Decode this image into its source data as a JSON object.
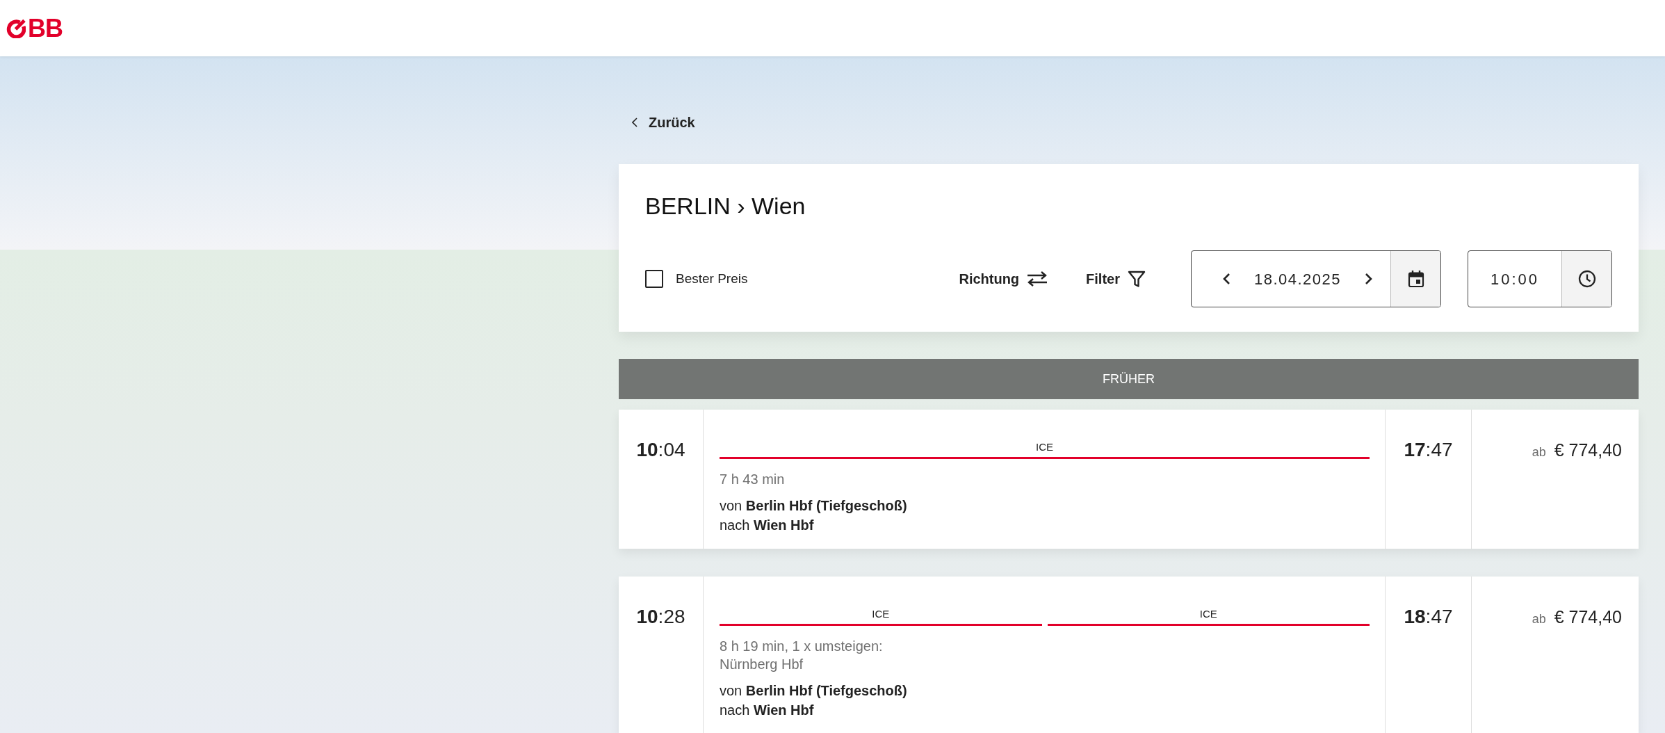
{
  "header": {
    "logo_text": "BB"
  },
  "back_link": {
    "label": "Zurück"
  },
  "search": {
    "title": "BERLIN › Wien",
    "best_price": {
      "label": "Bester Preis",
      "checked": false
    },
    "direction_button": "Richtung",
    "filter_button": "Filter",
    "date": "18.04.2025",
    "time": "10:00"
  },
  "earlier_button": "FRÜHER",
  "connections": [
    {
      "departure": "**10**:04",
      "segments": [
        {
          "label": "ICE"
        }
      ],
      "summary": "7 h 43 min",
      "origin": "von **Berlin Hbf (Tiefgeschoß)**",
      "destination": "nach **Wien Hbf**",
      "arrival": "**17**:47",
      "price_prefix": "ab",
      "price": "€ 774,40"
    },
    {
      "departure": "**10**:28",
      "segments": [
        {
          "label": "ICE"
        },
        {
          "label": "ICE"
        }
      ],
      "summary": "8 h 19 min, 1 x umsteigen: Nürnberg Hbf",
      "origin": "von **Berlin Hbf (Tiefgeschoß)**",
      "destination": "nach **Wien Hbf**",
      "arrival": "**18**:47",
      "price_prefix": "ab",
      "price": "€ 774,40"
    }
  ]
}
